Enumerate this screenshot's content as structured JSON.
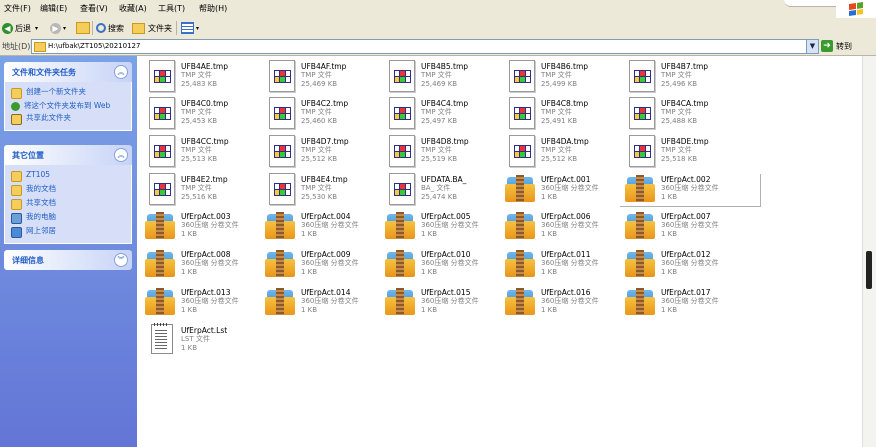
{
  "menu": [
    "文件(F)",
    "编辑(E)",
    "查看(V)",
    "收藏(A)",
    "工具(T)",
    "帮助(H)"
  ],
  "toolbar": {
    "back": "后退",
    "search": "搜索",
    "folders": "文件夹"
  },
  "address": {
    "label": "地址(D)",
    "path": "H:\\ufbak\\ZT105\\20210127",
    "go": "转到"
  },
  "left": {
    "tasks": {
      "title": "文件和文件夹任务",
      "items": [
        "创建一个新文件夹",
        "将这个文件夹发布到 Web",
        "共享此文件夹"
      ]
    },
    "places": {
      "title": "其它位置",
      "items": [
        "ZT105",
        "我的文档",
        "共享文档",
        "我的电脑",
        "网上邻居"
      ]
    },
    "details": {
      "title": "详细信息"
    }
  },
  "colors": {
    "leftpane": "#6d8ee0",
    "link": "#215dc6",
    "ok": "#3a9a2e"
  },
  "files": [
    {
      "name": "UFB4AE.tmp",
      "type": "TMP 文件",
      "size": "25,483 KB",
      "icon": "tmp"
    },
    {
      "name": "UFB4AF.tmp",
      "type": "TMP 文件",
      "size": "25,469 KB",
      "icon": "tmp"
    },
    {
      "name": "UFB4B5.tmp",
      "type": "TMP 文件",
      "size": "25,469 KB",
      "icon": "tmp"
    },
    {
      "name": "UFB4B6.tmp",
      "type": "TMP 文件",
      "size": "25,499 KB",
      "icon": "tmp"
    },
    {
      "name": "UFB4B7.tmp",
      "type": "TMP 文件",
      "size": "25,496 KB",
      "icon": "tmp"
    },
    {
      "name": "UFB4C0.tmp",
      "type": "TMP 文件",
      "size": "25,453 KB",
      "icon": "tmp"
    },
    {
      "name": "UFB4C2.tmp",
      "type": "TMP 文件",
      "size": "25,460 KB",
      "icon": "tmp"
    },
    {
      "name": "UFB4C4.tmp",
      "type": "TMP 文件",
      "size": "25,497 KB",
      "icon": "tmp"
    },
    {
      "name": "UFB4C8.tmp",
      "type": "TMP 文件",
      "size": "25,491 KB",
      "icon": "tmp"
    },
    {
      "name": "UFB4CA.tmp",
      "type": "TMP 文件",
      "size": "25,488 KB",
      "icon": "tmp"
    },
    {
      "name": "UFB4CC.tmp",
      "type": "TMP 文件",
      "size": "25,513 KB",
      "icon": "tmp"
    },
    {
      "name": "UFB4D7.tmp",
      "type": "TMP 文件",
      "size": "25,512 KB",
      "icon": "tmp"
    },
    {
      "name": "UFB4D8.tmp",
      "type": "TMP 文件",
      "size": "25,519 KB",
      "icon": "tmp"
    },
    {
      "name": "UFB4DA.tmp",
      "type": "TMP 文件",
      "size": "25,512 KB",
      "icon": "tmp"
    },
    {
      "name": "UFB4DE.tmp",
      "type": "TMP 文件",
      "size": "25,518 KB",
      "icon": "tmp"
    },
    {
      "name": "UFB4E2.tmp",
      "type": "TMP 文件",
      "size": "25,516 KB",
      "icon": "tmp"
    },
    {
      "name": "UFB4E4.tmp",
      "type": "TMP 文件",
      "size": "25,530 KB",
      "icon": "tmp"
    },
    {
      "name": "UFDATA.BA_",
      "type": "BA_ 文件",
      "size": "25,474 KB",
      "icon": "tmp"
    },
    {
      "name": "UfErpAct.001",
      "type": "360压缩 分卷文件",
      "size": "1 KB",
      "icon": "zip"
    },
    {
      "name": "UfErpAct.002",
      "type": "360压缩 分卷文件",
      "size": "1 KB",
      "icon": "zip"
    },
    {
      "name": "UfErpAct.003",
      "type": "360压缩 分卷文件",
      "size": "1 KB",
      "icon": "zip"
    },
    {
      "name": "UfErpAct.004",
      "type": "360压缩 分卷文件",
      "size": "1 KB",
      "icon": "zip"
    },
    {
      "name": "UfErpAct.005",
      "type": "360压缩 分卷文件",
      "size": "1 KB",
      "icon": "zip"
    },
    {
      "name": "UfErpAct.006",
      "type": "360压缩 分卷文件",
      "size": "1 KB",
      "icon": "zip"
    },
    {
      "name": "UfErpAct.007",
      "type": "360压缩 分卷文件",
      "size": "1 KB",
      "icon": "zip"
    },
    {
      "name": "UfErpAct.008",
      "type": "360压缩 分卷文件",
      "size": "1 KB",
      "icon": "zip"
    },
    {
      "name": "UfErpAct.009",
      "type": "360压缩 分卷文件",
      "size": "1 KB",
      "icon": "zip"
    },
    {
      "name": "UfErpAct.010",
      "type": "360压缩 分卷文件",
      "size": "1 KB",
      "icon": "zip"
    },
    {
      "name": "UfErpAct.011",
      "type": "360压缩 分卷文件",
      "size": "1 KB",
      "icon": "zip"
    },
    {
      "name": "UfErpAct.012",
      "type": "360压缩 分卷文件",
      "size": "1 KB",
      "icon": "zip"
    },
    {
      "name": "UfErpAct.013",
      "type": "360压缩 分卷文件",
      "size": "1 KB",
      "icon": "zip"
    },
    {
      "name": "UfErpAct.014",
      "type": "360压缩 分卷文件",
      "size": "1 KB",
      "icon": "zip"
    },
    {
      "name": "UfErpAct.015",
      "type": "360压缩 分卷文件",
      "size": "1 KB",
      "icon": "zip"
    },
    {
      "name": "UfErpAct.016",
      "type": "360压缩 分卷文件",
      "size": "1 KB",
      "icon": "zip"
    },
    {
      "name": "UfErpAct.017",
      "type": "360压缩 分卷文件",
      "size": "1 KB",
      "icon": "zip"
    },
    {
      "name": "UfErpAct.Lst",
      "type": "LST 文件",
      "size": "1 KB",
      "icon": "txt"
    }
  ]
}
